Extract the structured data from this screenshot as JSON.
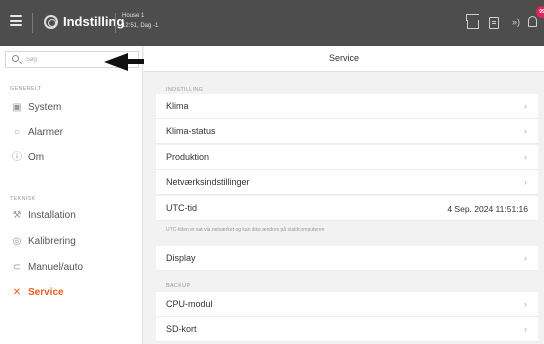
{
  "topbar": {
    "title": "Indstilling",
    "house_name": "House 1",
    "house_time": "12:51, Dag -1",
    "alarm_count": "99"
  },
  "sidebar": {
    "search_placeholder": "Søg",
    "sections": [
      {
        "label": "GENERELT",
        "items": [
          {
            "label": "System",
            "icon": "monitor-icon"
          },
          {
            "label": "Alarmer",
            "icon": "bell-icon"
          },
          {
            "label": "Om",
            "icon": "info-icon"
          }
        ]
      },
      {
        "label": "TEKNISK",
        "items": [
          {
            "label": "Installation",
            "icon": "tools-icon"
          },
          {
            "label": "Kalibrering",
            "icon": "target-icon"
          },
          {
            "label": "Manuel/auto",
            "icon": "toggle-icon"
          },
          {
            "label": "Service",
            "icon": "wrench-icon",
            "active": true
          }
        ]
      }
    ]
  },
  "main": {
    "title": "Service",
    "groups": [
      {
        "label": "INDSTILLING",
        "rows": [
          {
            "label": "Klima"
          },
          {
            "label": "Klima-status"
          },
          {
            "label": "Produktion"
          },
          {
            "label": "Netværksindstillinger"
          },
          {
            "label": "UTC-tid",
            "value": "4 Sep. 2024 11:51:16"
          }
        ],
        "note": "UTC-tiden er sat via netværket og kan ikke ændres på staldcomputeren"
      },
      {
        "rows": [
          {
            "label": "Display"
          }
        ]
      },
      {
        "label": "BACKUP",
        "rows": [
          {
            "label": "CPU-modul"
          },
          {
            "label": "SD-kort"
          }
        ]
      }
    ]
  },
  "colors": {
    "topbar": "#4d4d4d",
    "accent": "#e8601c",
    "badge": "#e0245e"
  }
}
